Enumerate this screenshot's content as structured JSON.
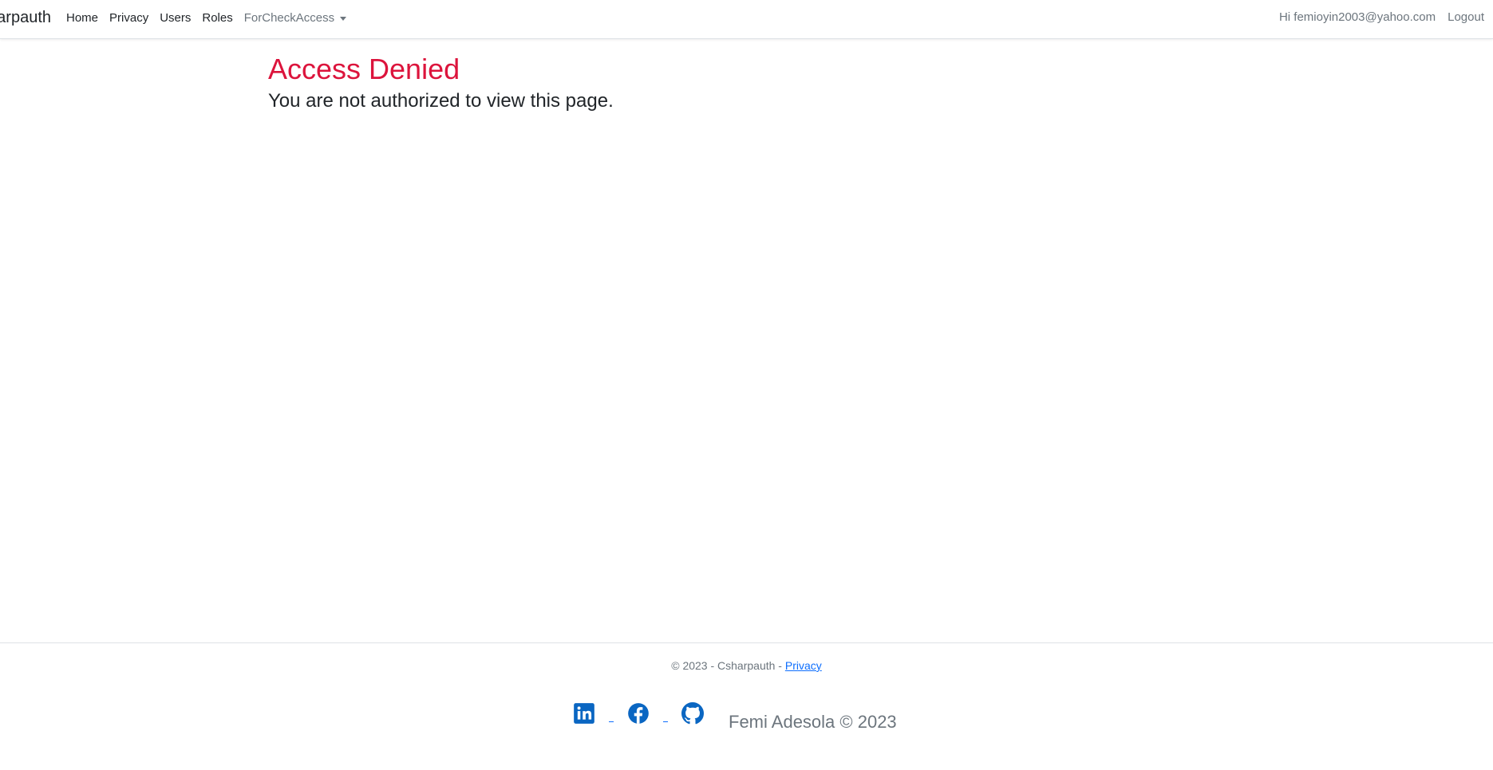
{
  "nav": {
    "brand": "Csharpauth",
    "links": [
      "Home",
      "Privacy",
      "Users",
      "Roles"
    ],
    "dropdown": "ForCheckAccess",
    "greeting": "Hi femioyin2003@yahoo.com",
    "logout": "Logout"
  },
  "main": {
    "title": "Access Denied",
    "message": "You are not authorized to view this page."
  },
  "footer": {
    "copyright": "© 2023 - Csharpauth - ",
    "privacy_link": "Privacy",
    "social_icons": [
      "linkedin-icon",
      "facebook-icon",
      "github-icon"
    ],
    "signature": "Femi Adesola © 2023"
  },
  "colors": {
    "title": "#dc143c",
    "link": "#0d6efd",
    "social": "#0a66c2",
    "muted": "#6c757d"
  }
}
